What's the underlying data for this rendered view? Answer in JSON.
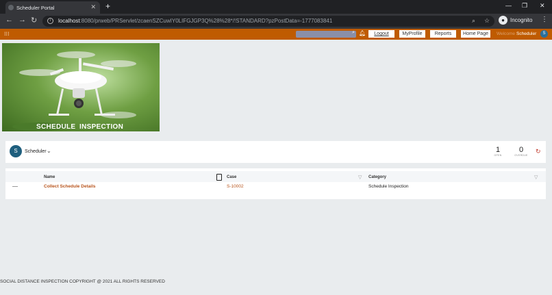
{
  "browser": {
    "tab_title": "Scheduler Portal",
    "url_host": "localhost",
    "url_rest": ":8080/prweb/PRServlet/zcaenSZCuwIY0LIFGJGP3Q%28%28*/!STANDARD?pzPostData=-1777083841",
    "incognito_label": "Incognito"
  },
  "header": {
    "logout_label": "Logout",
    "myprofile_label": "MyProfile",
    "reports_label": "Reports",
    "homepage_label": "Home Page",
    "welcome_text": "Welcome",
    "user_name": "Scheduler",
    "user_initial": "S"
  },
  "banner": {
    "word1": "SCHEDULE",
    "word2": "INSPECTION"
  },
  "worklist": {
    "avatar_initial": "S",
    "owner": "Scheduler",
    "open_count": "1",
    "open_label": "OPEN",
    "overdue_count": "0",
    "overdue_label": "OVERDUE"
  },
  "table": {
    "columns": [
      "Name",
      "Case",
      "Category"
    ],
    "rows": [
      {
        "name": "Collect Schedule Details",
        "case": "S-10002",
        "category": "Schedule Inspection"
      }
    ]
  },
  "footer": {
    "text": "SOCIAL DISTANCE INSPECTION COPYRIGHT @ 2021 ALL RIGHTS RESERVED"
  },
  "colors": {
    "header_bg": "#bf5b00",
    "link": "#b8541c",
    "avatar": "#1f5f7e"
  }
}
